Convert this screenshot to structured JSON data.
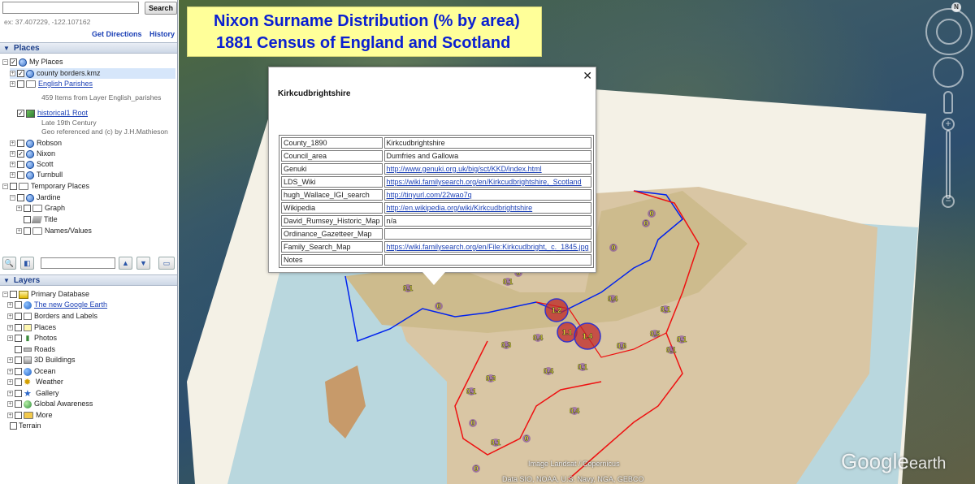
{
  "search": {
    "placeholder": "",
    "button_label": "Search",
    "hint": "ex: 37.407229, -122.107162",
    "get_directions": "Get Directions",
    "history": "History"
  },
  "places": {
    "header": "Places",
    "my_places": "My Places",
    "county_borders": "county borders.kmz",
    "english_parishes": "English Parishes",
    "english_parishes_sub": "459 Items from Layer English_parishes",
    "historical_root": "historical1 Root",
    "historical_sub1": "Late 19th Century",
    "historical_sub2": "Geo referenced and (c) by J.H.Mathieson",
    "robson": "Robson",
    "nixon": "Nixon",
    "scott": "Scott",
    "turnbull": "Turnbull",
    "temporary_places": "Temporary Places",
    "jardine": "Jardine",
    "graph": "Graph",
    "title": "Title",
    "names_values": "Names/Values"
  },
  "layers": {
    "header": "Layers",
    "primary_database": "Primary Database",
    "new_google_earth": "The new Google Earth",
    "borders_labels": "Borders and Labels",
    "places": "Places",
    "photos": "Photos",
    "roads": "Roads",
    "buildings": "3D Buildings",
    "ocean": "Ocean",
    "weather": "Weather",
    "gallery": "Gallery",
    "global_awareness": "Global Awareness",
    "more": "More",
    "terrain": "Terrain"
  },
  "map": {
    "title_line1": "Nixon Surname Distribution (% by area)",
    "title_line2": "1881 Census of England and Scotland",
    "compass_n": "N",
    "credit_image": "Image Landsat / Copernicus",
    "credit_data": "Data SIO, NOAA, U.S. Navy, NGA, GEBCO",
    "logo_google": "Google",
    "logo_earth": "earth",
    "markers": [
      {
        "label": "0.1"
      },
      {
        "label": "0"
      },
      {
        "label": "0.1"
      },
      {
        "label": "0"
      },
      {
        "label": "1.2"
      },
      {
        "label": "1.1"
      },
      {
        "label": "1.4"
      },
      {
        "label": "0.4"
      },
      {
        "label": "0.3"
      },
      {
        "label": "0.4"
      },
      {
        "label": "0.1"
      },
      {
        "label": "0.6"
      },
      {
        "label": "0.5"
      },
      {
        "label": "0.1"
      },
      {
        "label": "0.1"
      },
      {
        "label": "0.4"
      },
      {
        "label": "0.1"
      },
      {
        "label": "0.3"
      },
      {
        "label": "0.1"
      },
      {
        "label": "0"
      },
      {
        "label": "0.4"
      },
      {
        "label": "0.1"
      },
      {
        "label": "0"
      },
      {
        "label": "0"
      },
      {
        "label": "0"
      },
      {
        "label": "0"
      },
      {
        "label": "0"
      }
    ]
  },
  "popup": {
    "title": "Kirkcudbrightshire",
    "rows": [
      {
        "key": "County_1890",
        "value": "Kirkcudbrightshire"
      },
      {
        "key": "Council_area",
        "value": "Dumfries and Gallowa"
      },
      {
        "key": "Genuki",
        "value": "http://www.genuki.org.uk/big/sct/KKD/index.html"
      },
      {
        "key": "LDS_Wiki",
        "value": "https://wiki.familysearch.org/en/Kirkcudbrightshire,_Scotland"
      },
      {
        "key": "hugh_Wallace_IGI_search",
        "value": "http://tinyurl.com/22wao7q"
      },
      {
        "key": "Wikipedia",
        "value": "http://en.wikipedia.org/wiki/Kirkcudbrightshire"
      },
      {
        "key": "David_Rumsey_Historic_Map",
        "value": "n/a"
      },
      {
        "key": "Ordinance_Gazetteer_Map",
        "value": ""
      },
      {
        "key": "Family_Search_Map",
        "value": "https://wiki.familysearch.org/en/File:Kirkcudbright,_c._1845.jpg"
      },
      {
        "key": "Notes",
        "value": ""
      }
    ]
  }
}
